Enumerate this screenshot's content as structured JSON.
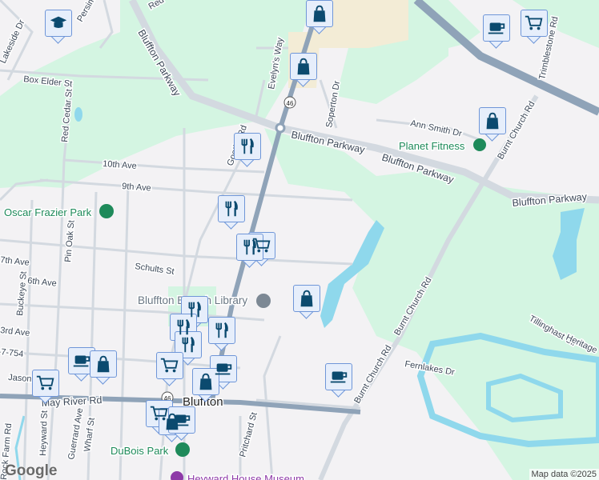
{
  "map": {
    "streets": {
      "bluffton_parkway": "Bluffton Parkway",
      "red_cedar": "Red Cedar St",
      "box_elder": "Box Elder St",
      "lakeside": "Lakeside Dr",
      "persimmon": "Persim",
      "red": "Red",
      "evelyns_way": "Evelyn's Way",
      "soperton": "Soperton Dr",
      "ann_smith": "Ann Smith Dr",
      "trimblestone": "Trimblestone Rd",
      "burnt_church": "Burnt Church Rd",
      "tenth": "10th Ave",
      "ninth": "9th Ave",
      "goethe": "Goethe Rd",
      "schults": "Schults St",
      "pin_oak": "Pin Oak St",
      "seventh": "7th Ave",
      "sixth": "6th Ave",
      "buckeye": "Buckeye St",
      "third": "3rd Ave",
      "sc754": "S-7-754",
      "jason": "Jason St",
      "may_river": "May River Rd",
      "heyward": "Heyward St",
      "guerrard": "Guerrard Ave",
      "wharf": "Wharf St",
      "pritchard": "Pritchard St",
      "fernlakes": "Fernlakes Dr",
      "tillinghast": "Tillinghast Cir",
      "heritage": "Heritage",
      "rock_farm": "Rock Farm Rd",
      "route": "46"
    },
    "places": {
      "oscar_frazier_park": "Oscar Frazier Park",
      "planet_fitness": "Planet Fitness",
      "library": "Bluffton Branch Library",
      "town": "Bluffton",
      "dubois_park": "DuBois Park",
      "heyward_house": "Heyward House Museum"
    },
    "attribution": "Map data ©2025",
    "logo": "Google"
  },
  "colors": {
    "green": "#d4f5e2",
    "road_major": "#8fa3b8",
    "road_parkway": "#d3d9e0",
    "water": "#8fd8ec",
    "marker_fill": "#e6eefb",
    "marker_border": "#6f96d8",
    "icon": "#0b4a6f"
  },
  "markers": [
    "school",
    "shopping",
    "shopping",
    "coffee",
    "grocery",
    "shopping",
    "restaurant",
    "restaurant",
    "grocery",
    "restaurant",
    "shopping",
    "restaurant",
    "restaurant",
    "restaurant",
    "restaurant",
    "coffee",
    "shopping",
    "grocery",
    "grocery",
    "coffee",
    "shopping",
    "coffee",
    "grocery",
    "shopping",
    "coffee"
  ]
}
